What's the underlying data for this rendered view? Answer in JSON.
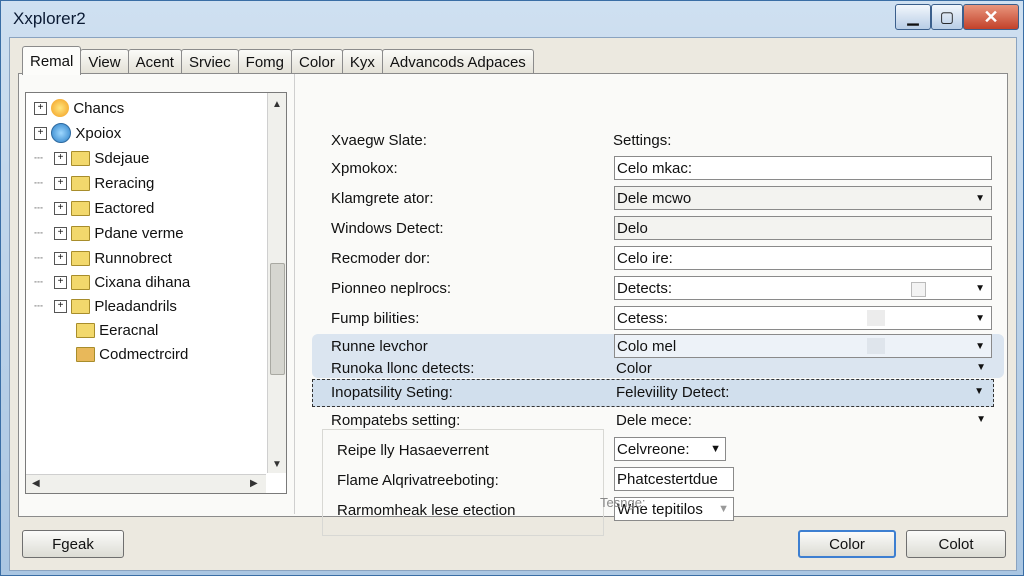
{
  "window": {
    "title": "Xxplorer2",
    "minimize": "▁",
    "maximize": "▢",
    "close": "✕"
  },
  "tabs": [
    {
      "label": "Remal",
      "active": true
    },
    {
      "label": "View"
    },
    {
      "label": "Acent"
    },
    {
      "label": "Srviec"
    },
    {
      "label": "Fomg"
    },
    {
      "label": "Color"
    },
    {
      "label": "Kyx"
    },
    {
      "label": "Advancods Adpaces"
    }
  ],
  "tree": [
    {
      "label": "Chancs",
      "icon": "sun-icon"
    },
    {
      "label": "Xpoiox",
      "icon": "globe-icon"
    },
    {
      "label": "Sdejaue",
      "icon": "folder-icon"
    },
    {
      "label": "Reracing",
      "icon": "lock-folder-icon"
    },
    {
      "label": "Eactored",
      "icon": "lock-folder-icon"
    },
    {
      "label": "Pdane verme",
      "icon": "folder-icon"
    },
    {
      "label": "Runnobrect",
      "icon": "lock-folder-icon"
    },
    {
      "label": "Cixana dihana",
      "icon": "folder-icon"
    },
    {
      "label": "Pleadandrils",
      "icon": "folder-icon"
    },
    {
      "label": "Eeracnal",
      "icon": "folder-icon"
    },
    {
      "label": "Codmectrcird",
      "icon": "folder-open-icon"
    }
  ],
  "settings": {
    "header_left": "Xvaegw Slate:",
    "header_right": "Settings:",
    "rows": [
      {
        "label": "Xpmokox:",
        "value": "Celo mkac:"
      },
      {
        "label": "Klamgrete ator:",
        "value": "Dele mcwo"
      },
      {
        "label": "Windows Detect:",
        "value": "Delo"
      },
      {
        "label": "Recmoder dor:",
        "value": "Celo ire:"
      },
      {
        "label": "Pionneo neplrocs:",
        "value": "Detects:"
      },
      {
        "label": "Fump bilities:",
        "value": "Cetess:"
      },
      {
        "label": "Runne levchor",
        "value": "Colo mel"
      },
      {
        "label": "Runoka llonc detects:",
        "value": "Color"
      },
      {
        "label": "Inopatsility Seting:",
        "value": "Feleviility Detect:"
      },
      {
        "label": "Rompatebs setting:",
        "value": "Dele mece:"
      }
    ],
    "sub_rows": [
      {
        "label": "Reipe lly Hasaeverrent",
        "value": "Celvreone:"
      },
      {
        "label": "Flame Alqrivatreeboting:",
        "value": "Phatcestertdue"
      },
      {
        "label": "Rarmomheak lese etection",
        "value": "Whe tepitilos"
      }
    ],
    "footer": "Tesnge:"
  },
  "buttons": {
    "left": "Fgeak",
    "ok": "Color",
    "cancel": "Colot"
  }
}
